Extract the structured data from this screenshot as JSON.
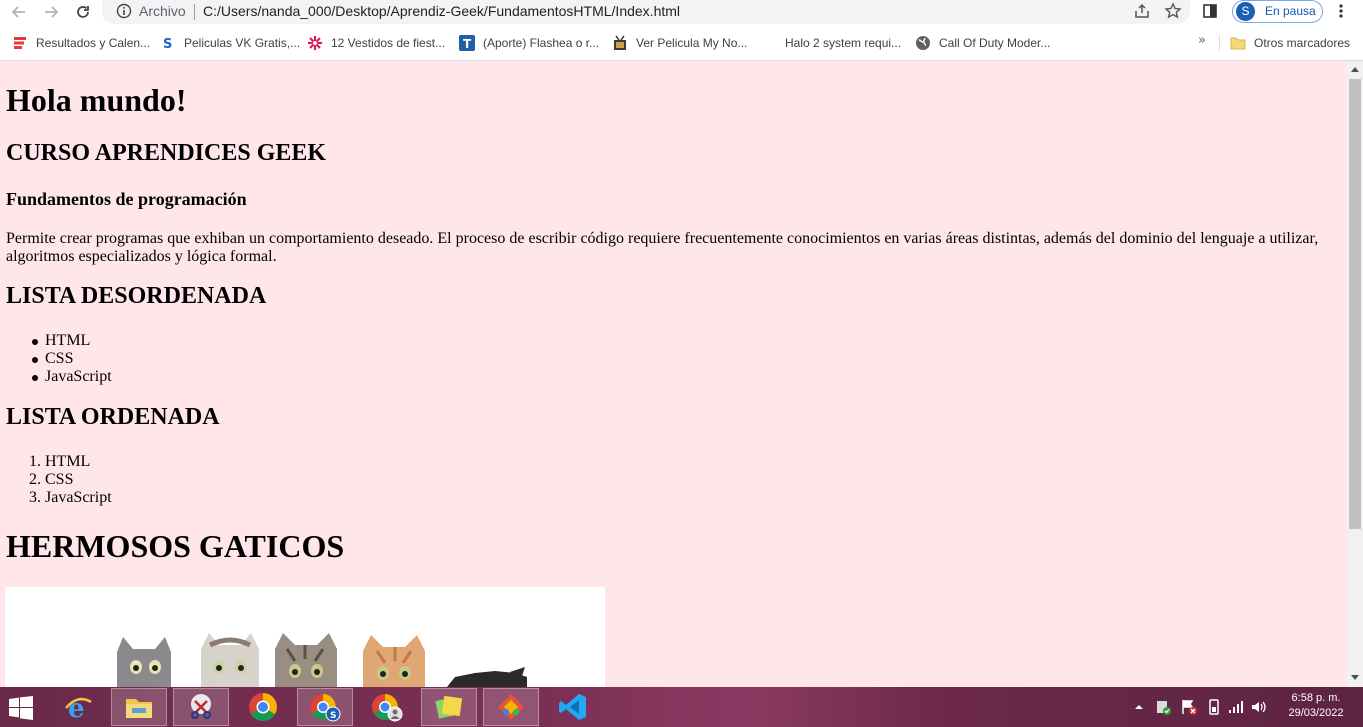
{
  "browser": {
    "url_scheme_label": "Archivo",
    "url": "C:/Users/nanda_000/Desktop/Aprendiz-Geek/FundamentosHTML/Index.html",
    "profile_initial": "S",
    "profile_status": "En pausa"
  },
  "bookmarks": {
    "items": [
      {
        "label": "Resultados y Calen...",
        "icon": "red-stripes-icon"
      },
      {
        "label": "Peliculas VK Gratis,...",
        "icon": "s-logo-icon"
      },
      {
        "label": "12 Vestidos de fiest...",
        "icon": "flower-icon"
      },
      {
        "label": "(Aporte) Flashea o r...",
        "icon": "t-logo-icon"
      },
      {
        "label": "Ver Pelicula My No...",
        "icon": "film-icon"
      },
      {
        "label": "Halo 2 system requi...",
        "icon": ""
      },
      {
        "label": "Call Of Duty Moder...",
        "icon": "globe-icon"
      }
    ],
    "overflow": "»",
    "other_folder": "Otros marcadores"
  },
  "page": {
    "h1": "Hola mundo!",
    "h2": "CURSO APRENDICES GEEK",
    "h3": "Fundamentos de programación",
    "paragraph": "Permite crear programas que exhiban un comportamiento deseado. El proceso de escribir código requiere frecuentemente conocimientos en varias áreas distintas, además del dominio del lenguaje a utilizar, algoritmos especializados y lógica formal.",
    "unordered_title": "LISTA DESORDENADA",
    "unordered_items": [
      "HTML",
      "CSS",
      "JavaScript"
    ],
    "ordered_title": "LISTA ORDENADA",
    "ordered_items": [
      "HTML",
      "CSS",
      "JavaScript"
    ],
    "ordered_numbers": [
      "1.",
      "2.",
      "3."
    ],
    "cats_title": "HERMOSOS GATICOS"
  },
  "taskbar": {
    "apps": [
      "start",
      "internet-explorer",
      "file-explorer",
      "snipping-tool",
      "chrome",
      "chrome-profile-s",
      "chrome-profile-other",
      "sticky-notes",
      "gitkraken",
      "vscode"
    ],
    "time": "6:58 p. m.",
    "date": "29/03/2022"
  },
  "colors": {
    "page_background": "#ffe6ea",
    "taskbar": "#7b2f55",
    "profile_accent": "#1a5fb4"
  }
}
